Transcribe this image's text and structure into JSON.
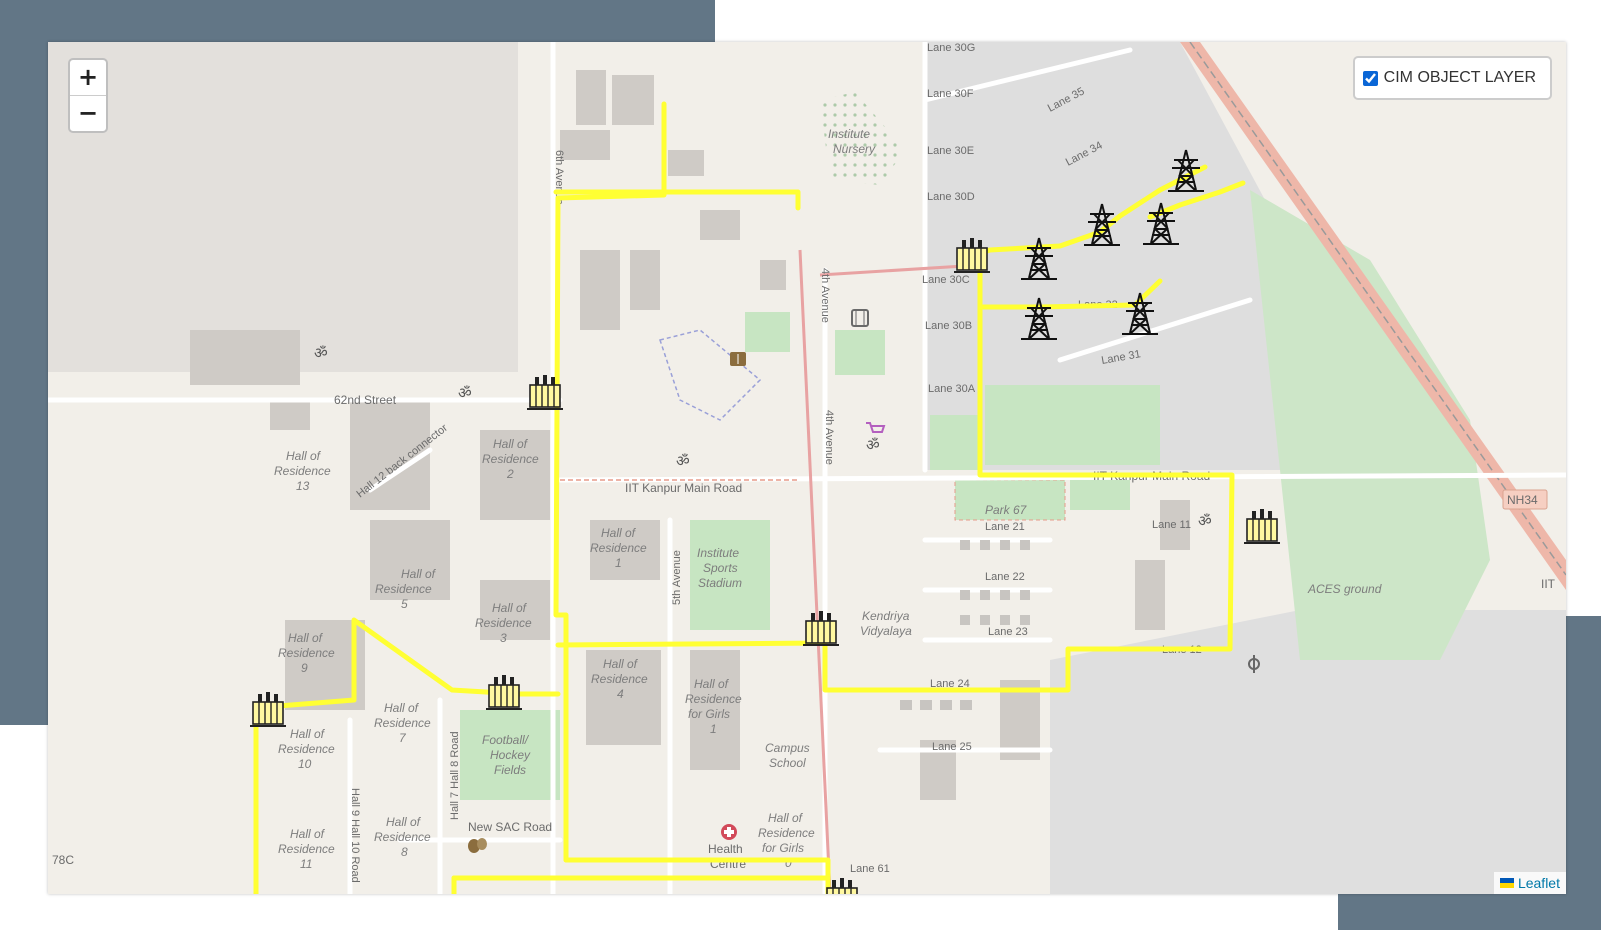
{
  "zoom": {
    "in_label": "+",
    "out_label": "−"
  },
  "layer_control": {
    "label": "CIM OBJECT LAYER",
    "checked": true
  },
  "attribution": {
    "text": "Leaflet"
  },
  "colors": {
    "power_line": "#ffff33",
    "background_panel": "#627686"
  },
  "map_labels": {
    "lane_30g": "Lane 30G",
    "lane_30f": "Lane 30F",
    "lane_30e": "Lane 30E",
    "lane_30d": "Lane 30D",
    "lane_30c": "Lane 30C",
    "lane_30b": "Lane 30B",
    "lane_30a": "Lane 30A",
    "lane_35": "Lane 35",
    "lane_34": "Lane 34",
    "lane_32": "Lane 32",
    "lane_31": "Lane 31",
    "institute_nursery_1": "Institute",
    "institute_nursery_2": "Nursery",
    "sixth_avenue": "6th Avenue",
    "fourth_avenue": "4th Avenue",
    "fifth_avenue": "5th Avenue",
    "street_62nd": "62nd Street",
    "hall_13_1": "Hall of",
    "hall_13_2": "Residence",
    "hall_13_3": "13",
    "hall_12_connector": "Hall 12 back connector",
    "hall_2_1": "Hall of",
    "hall_2_2": "Residence",
    "hall_2_3": "2",
    "main_road_west": "IIT Kanpur Main Road",
    "main_road_east": "IIT Kanpur Main Road",
    "hall_1_1": "Hall of",
    "hall_1_2": "Residence",
    "hall_1_3": "1",
    "stadium_1": "Institute",
    "stadium_2": "Sports",
    "stadium_3": "Stadium",
    "park_67": "Park 67",
    "lane_21": "Lane 21",
    "lane_22": "Lane 22",
    "lane_23": "Lane 23",
    "lane_24": "Lane 24",
    "lane_25": "Lane 25",
    "lane_11": "Lane 11",
    "lane_12": "Lane 12",
    "lane_61": "Lane 61",
    "nh34": "NH34",
    "aces_ground": "ACES ground",
    "iit_edge": "IIT",
    "hall_5_1": "Hall of",
    "hall_5_2": "Residence",
    "hall_5_3": "5",
    "hall_3_1": "Hall of",
    "hall_3_2": "Residence",
    "hall_3_3": "3",
    "hall_9_1": "Hall of",
    "hall_9_2": "Residence",
    "hall_9_3": "9",
    "hall_7_1": "Hall of",
    "hall_7_2": "Residence",
    "hall_7_3": "7",
    "hall_10_1": "Hall of",
    "hall_10_2": "Residence",
    "hall_10_3": "10",
    "hall_11_1": "Hall of",
    "hall_11_2": "Residence",
    "hall_11_3": "11",
    "hall_8_1": "Hall of",
    "hall_8_2": "Residence",
    "hall_8_3": "8",
    "hall_4_1": "Hall of",
    "hall_4_2": "Residence",
    "hall_4_3": "4",
    "girls1_1": "Hall of",
    "girls1_2": "Residence",
    "girls1_3": "for Girls",
    "girls1_4": "1",
    "girls_b_1": "Hall of",
    "girls_b_2": "Residence",
    "girls_b_3": "for Girls",
    "girls_b_4": "0",
    "kv_1": "Kendriya",
    "kv_2": "Vidyalaya",
    "campus_school_1": "Campus",
    "campus_school_2": "School",
    "football_1": "Football/",
    "football_2": "Hockey",
    "football_3": "Fields",
    "hall7_hall8_road": "Hall 7 Hall 8 Road",
    "hall9_hall10_road": "Hall 9 Hall 10 Road",
    "new_sac_road": "New SAC Road",
    "health_1": "Health",
    "health_2": "Centre",
    "edge_78c": "78C"
  },
  "icons": {
    "substation": "transformer-substation-icon",
    "tower": "transmission-tower-icon",
    "temple": "om-temple-icon",
    "library": "library-book-icon",
    "hospital": "hospital-cross-icon",
    "theatre": "theatre-masks-icon",
    "shop": "shopping-cart-icon",
    "cinema": "film-icon",
    "gurdwara": "khanda-icon"
  }
}
